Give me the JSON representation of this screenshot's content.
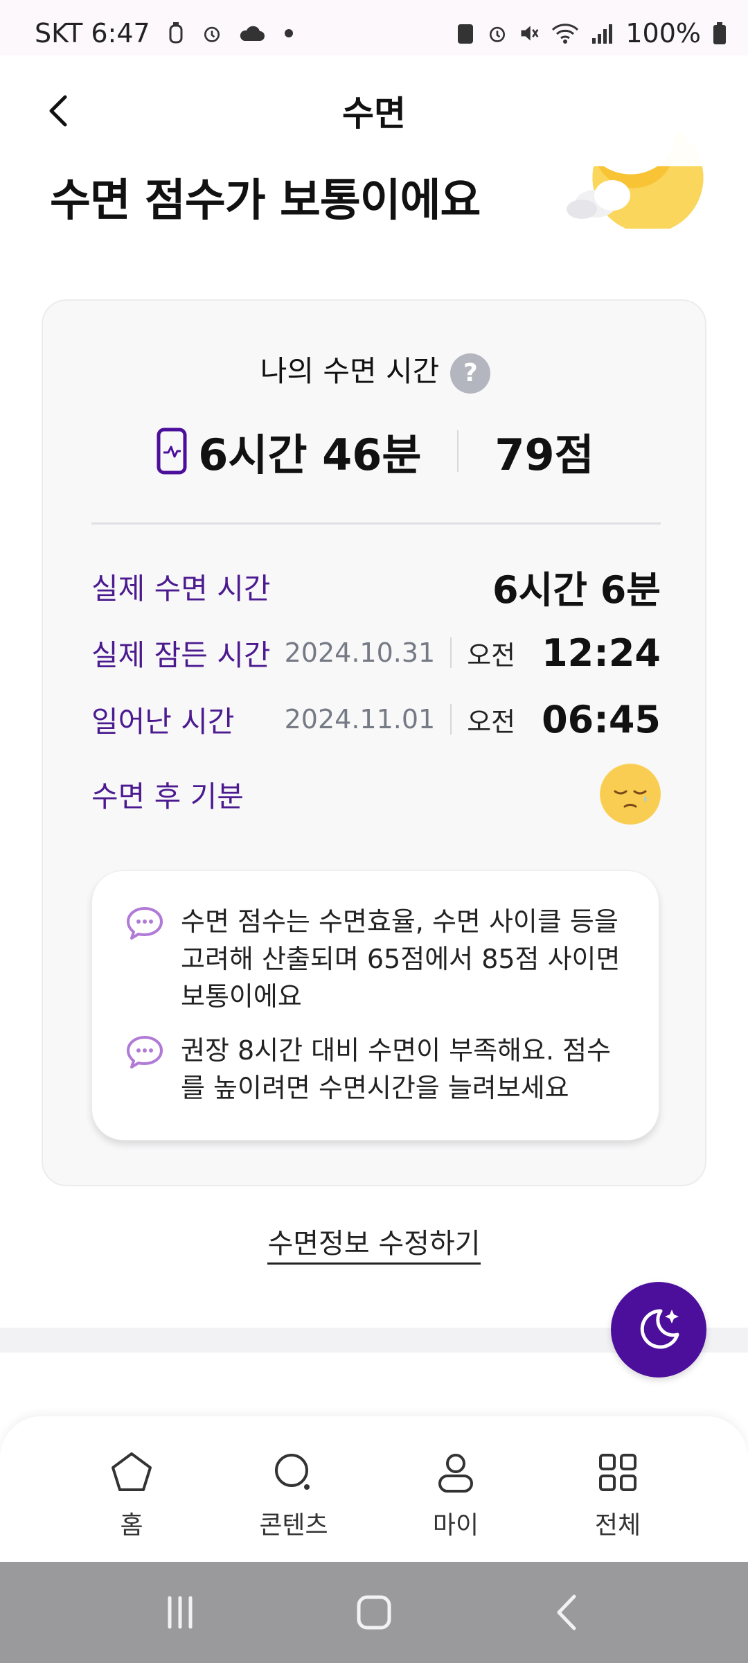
{
  "status_bar": {
    "carrier_time": "SKT 6:47",
    "battery": "100%"
  },
  "header": {
    "title": "수면"
  },
  "headline": "수면 점수가 보통이에요",
  "summary": {
    "section_title": "나의 수면 시간",
    "duration": "6시간 46분",
    "score": "79점"
  },
  "details": [
    {
      "label": "실제 수면 시간",
      "value": "6시간 6분"
    },
    {
      "label": "실제 잠든 시간",
      "date": "2024.10.31",
      "ampm": "오전",
      "time": "12:24"
    },
    {
      "label": "일어난 시간",
      "date": "2024.11.01",
      "ampm": "오전",
      "time": "06:45"
    },
    {
      "label": "수면 후 기분"
    }
  ],
  "tips": [
    {
      "text": "수면 점수는 수면효율, 수면 사이클 등을 고려해 산출되며 65점에서 85점 사이면 보통이에요"
    },
    {
      "text": "권장 8시간 대비 수면이 부족해요. 점수를 높이려면 수면시간을 늘려보세요"
    }
  ],
  "edit_link": "수면정보 수정하기",
  "bottom_nav": [
    {
      "label": "홈",
      "icon": "home-icon"
    },
    {
      "label": "콘텐츠",
      "icon": "search-icon"
    },
    {
      "label": "마이",
      "icon": "person-icon"
    },
    {
      "label": "전체",
      "icon": "grid-icon"
    }
  ],
  "colors": {
    "accent": "#4b0f9c",
    "label_purple": "#4b1a8f"
  }
}
